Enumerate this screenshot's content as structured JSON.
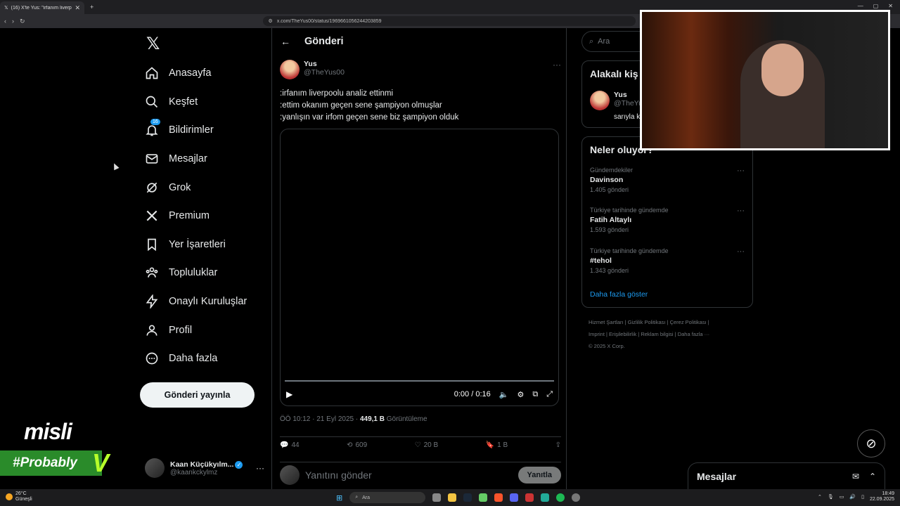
{
  "browser": {
    "tab_title": "(16) X'te Yus: \"irfanım liverpoolu",
    "url": "x.com/TheYus00/status/1969661056244203859"
  },
  "nav": {
    "items": [
      {
        "label": "Anasayfa",
        "icon": "home-icon"
      },
      {
        "label": "Keşfet",
        "icon": "search-icon"
      },
      {
        "label": "Bildirimler",
        "icon": "bell-icon",
        "badge": "16"
      },
      {
        "label": "Mesajlar",
        "icon": "mail-icon"
      },
      {
        "label": "Grok",
        "icon": "grok-icon"
      },
      {
        "label": "Premium",
        "icon": "x-logo-icon"
      },
      {
        "label": "Yer İşaretleri",
        "icon": "bookmark-icon"
      },
      {
        "label": "Topluluklar",
        "icon": "people-icon"
      },
      {
        "label": "Onaylı Kuruluşlar",
        "icon": "lightning-icon"
      },
      {
        "label": "Profil",
        "icon": "person-icon"
      },
      {
        "label": "Daha fazla",
        "icon": "more-circle-icon"
      }
    ],
    "post_button": "Gönderi yayınla",
    "account": {
      "name": "Kaan Küçükyılm...",
      "handle": "@kaankckylmz"
    }
  },
  "main": {
    "title": "Gönderi",
    "tweet": {
      "author_name": "Yus",
      "author_handle": "@TheYus00",
      "lines": [
        ":irfanım liverpoolu analiz ettinmi",
        ":ettim okanım geçen sene şampiyon olmuşlar",
        ":yanlışın var irfom geçen sene biz şampiyon olduk"
      ],
      "video_time": "0:00 / 0:16",
      "video_progress": 0,
      "meta_time": "ÖÖ 10:12 · 21 Eyl 2025 · ",
      "views_count": "449,1 B",
      "views_label": " Görüntüleme",
      "replies": "44",
      "reposts": "609",
      "likes": "20 B",
      "bookmarks": "1 B"
    },
    "reply_placeholder": "Yanıtını gönder",
    "reply_button": "Yanıtla"
  },
  "right": {
    "search_placeholder": "Ara",
    "related_title": "Alakalı kiş",
    "related_user": {
      "name": "Yus",
      "handle": "@TheYu",
      "bio": "sarıyla k"
    },
    "trends_title": "Neler oluyor?",
    "trends": [
      {
        "context": "Gündemdekiler",
        "name": "Davinson",
        "count": "1.405 gönderi"
      },
      {
        "context": "Türkiye tarihinde gündemde",
        "name": "Fatih Altaylı",
        "count": "1.593 gönderi"
      },
      {
        "context": "Türkiye tarihinde gündemde",
        "name": "#tehol",
        "count": "1.343 gönderi"
      }
    ],
    "show_more": "Daha fazla göster",
    "footer_line1": "Hizmet Şartları  |  Gizlilik Politikası  |  Çerez Politikası  |",
    "footer_line2": "Imprint  |  Erişilebilirlik  |  Reklam bilgisi  |  Daha fazla ···",
    "footer_line3": "© 2025 X Corp."
  },
  "messages_drawer": {
    "title": "Mesajlar"
  },
  "overlay": {
    "brand": "misli",
    "hashtag": "#Probably"
  },
  "taskbar": {
    "weather_temp": "26°C",
    "weather_desc": "Güneşli",
    "search": "Ara",
    "time": "18:49",
    "date": "22.09.2025"
  }
}
